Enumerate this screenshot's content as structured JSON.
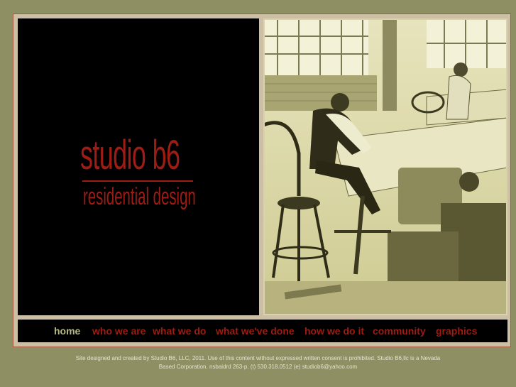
{
  "brand": {
    "title": "studio b6",
    "subtitle": "residential design"
  },
  "photo": {
    "icon": "drafting-room-photo"
  },
  "nav": {
    "items": [
      {
        "label": "home",
        "active": true
      },
      {
        "label": "who we are",
        "active": false
      },
      {
        "label": "what we do",
        "active": false
      },
      {
        "label": "what we've done",
        "active": false
      },
      {
        "label": "how we do it",
        "active": false
      },
      {
        "label": "community",
        "active": false
      },
      {
        "label": "graphics",
        "active": false
      }
    ]
  },
  "footer": {
    "line1": "Site designed and created by Studio B6, LLC, 2011. Use of this content without expressed written consent is prohibited. Studio B6,llc is a Nevada",
    "line2": "Based Corporation. nsbaidrd 263-p. (t) 530.318.0512 (e) studiob6@yahoo.com"
  },
  "colors": {
    "page_bg": "#8f8f64",
    "brand_red": "#9d1c14",
    "nav_active": "#b8b88a"
  }
}
